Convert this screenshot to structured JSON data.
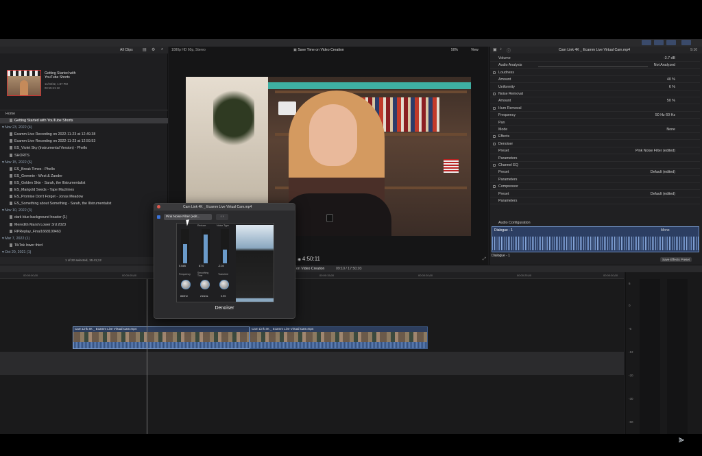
{
  "toolbar": {
    "clips_filter": "All Clips",
    "format": "1080p HD 60p, Stereo",
    "project_name": "Save Time on Video Creation",
    "zoom": "50%",
    "view_label": "View",
    "inspector_title": "Cam Link 4K _ Ecamm Live Virtual Cam.mp4",
    "duration_short": "9:10"
  },
  "browser": {
    "featured_title": "Getting Started with YouTube Shorts",
    "featured_meta": "11/23/22, 1:37 PM",
    "featured_duration": "00:15:41:12",
    "home_label": "Home",
    "rows": [
      {
        "text": "Getting Started with YouTube Shorts",
        "kind": "sel"
      },
      {
        "text": "▾ Nov 23, 2022  (4)",
        "kind": "grp"
      },
      {
        "text": "Ecamm Live Recording on 2022-11-23 at 12.49.38",
        "kind": "item"
      },
      {
        "text": "Ecamm Live Recording on 2022-11-23 at 12.59.53",
        "kind": "item"
      },
      {
        "text": "ES_Violet Sky (Instrumental Version) - Phello",
        "kind": "item"
      },
      {
        "text": "SHORTS",
        "kind": "item"
      },
      {
        "text": "▾ Nov 15, 2022  (6)",
        "kind": "grp"
      },
      {
        "text": "ES_Break Times - Phello",
        "kind": "item"
      },
      {
        "text": "ES_Gemmie - West & Zander",
        "kind": "item"
      },
      {
        "text": "ES_Golden Skin - Sarah, the Illstrumentalist",
        "kind": "item"
      },
      {
        "text": "ES_Marigold Seeds - Tape Machines",
        "kind": "item"
      },
      {
        "text": "ES_Promise Don't Forget - Jonas Meadow",
        "kind": "item"
      },
      {
        "text": "ES_Something about Something - Sarah, the Illstrumentalist",
        "kind": "item"
      },
      {
        "text": "▾ Nov 10, 2022  (3)",
        "kind": "grp"
      },
      {
        "text": "dark blue background header (1)",
        "kind": "item"
      },
      {
        "text": "Meredith Marsh Lower 3rd 2023",
        "kind": "item"
      },
      {
        "text": "RPReplay_Final1668100463",
        "kind": "item"
      },
      {
        "text": "▾ Mar 7, 2022  (1)",
        "kind": "grp"
      },
      {
        "text": "TikTok lower third",
        "kind": "item"
      },
      {
        "text": "▾ Oct 20, 2021  (1)",
        "kind": "grp"
      }
    ],
    "status": "1 of 22 selected, 15:41;12"
  },
  "viewer": {
    "timecode": "4:50:11"
  },
  "inspector": {
    "rows": [
      {
        "label": "Volume",
        "value": "-3.7  dB"
      },
      {
        "label": "Audio Analysis",
        "value": "Not Analyzed"
      },
      {
        "label": "Loudness",
        "value": ""
      },
      {
        "label": "Amount",
        "value": "40  %"
      },
      {
        "label": "Uniformity",
        "value": "6  %"
      },
      {
        "label": "Noise Removal",
        "value": ""
      },
      {
        "label": "Amount",
        "value": "50  %"
      },
      {
        "label": "Hum Removal",
        "value": ""
      },
      {
        "label": "Frequency",
        "value": "50 Hz    60 Hz"
      },
      {
        "label": "Pan",
        "value": ""
      },
      {
        "label": "Mode",
        "value": "None"
      },
      {
        "label": "Effects",
        "value": ""
      },
      {
        "label": "Denoiser",
        "value": ""
      },
      {
        "label": "Preset",
        "value": "Pink Noise Filter (edited)"
      },
      {
        "label": "Parameters",
        "value": ""
      },
      {
        "label": "Channel EQ",
        "value": ""
      },
      {
        "label": "Preset",
        "value": "Default (edited)"
      },
      {
        "label": "Parameters",
        "value": ""
      },
      {
        "label": "Compressor",
        "value": ""
      },
      {
        "label": "Preset",
        "value": "Default (edited)"
      },
      {
        "label": "Parameters",
        "value": ""
      }
    ],
    "audio_config_label": "Audio Configuration",
    "dialogue_label": "Dialogue - 1",
    "dialogue_mode": "Mono",
    "dialogue_select": "Dialogue - 1",
    "save_preset": "Save Effects Preset"
  },
  "timeline": {
    "project_label": "on Video Creation",
    "timecode": "09:10 / 17:50;03",
    "ruler": [
      "00:00:00;00",
      "00:00:05;00",
      "00:00:10;00",
      "00:00:15;00",
      "00:00:20;00",
      "00:00:25;00",
      "00:00:30;00"
    ],
    "clips": [
      {
        "title": "Cam Link 4K _ Ecamm Live Virtual Cam.mp4"
      },
      {
        "title": "Cam Link 4K _ Ecamm Live Virtual Cam.mp4"
      }
    ],
    "meter_scale": [
      "6",
      "0",
      "-6",
      "-12",
      "-20",
      "-30",
      "-50"
    ]
  },
  "dialog": {
    "title": "Cam Link 4K _ Ecamm Live Virtual Cam.mp4",
    "preset": "Pink Noise Filter (edit...",
    "labels": [
      "Reduce",
      "Noise Type"
    ],
    "values_top": [
      "0.0dB",
      "-2.04",
      "87.0"
    ],
    "knob_labels": [
      "Frequency",
      "Smoothing Time",
      "Transient"
    ],
    "knob_values": [
      "840Hz",
      "213ms",
      "0.95"
    ],
    "name": "Denoiser"
  }
}
